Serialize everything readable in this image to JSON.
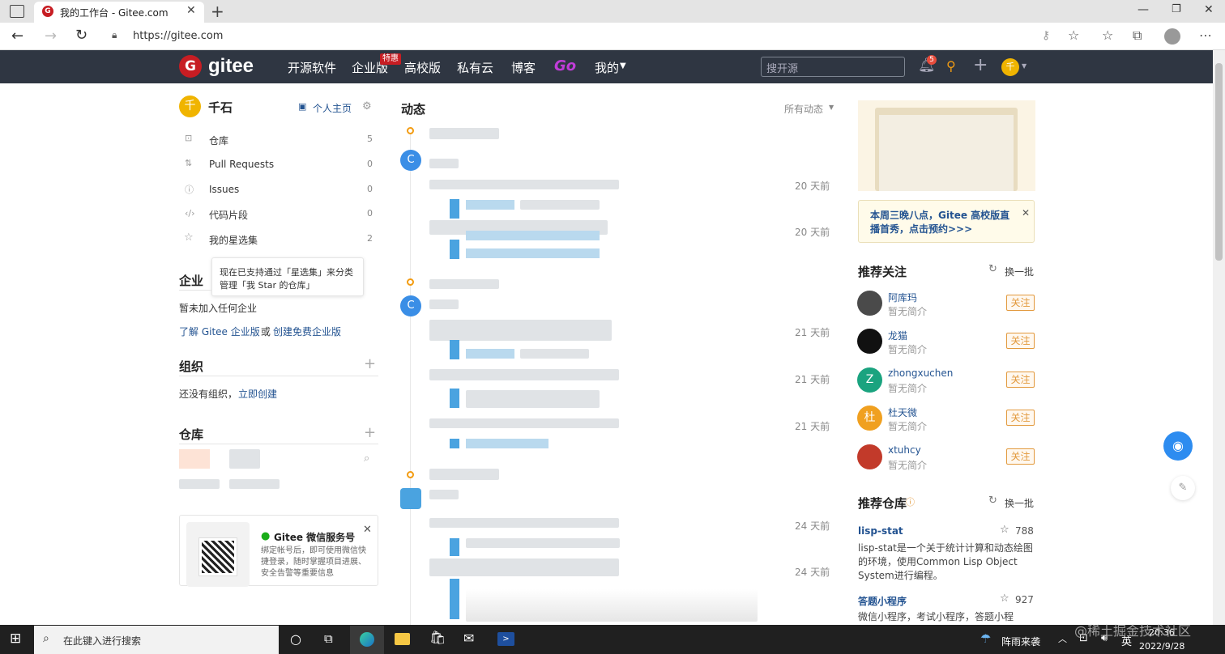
{
  "browser": {
    "tab_title": "我的工作台 - Gitee.com",
    "url": "https://gitee.com"
  },
  "header": {
    "logo": "gitee",
    "nav": [
      "开源软件",
      "企业版",
      "高校版",
      "私有云",
      "博客",
      "Go",
      "我的"
    ],
    "badge_special": "特惠",
    "search_placeholder": "搜开源",
    "notif_count": "5",
    "avatar_char": "千"
  },
  "sidebar": {
    "username": "千石",
    "avatar_char": "千",
    "home_link": "个人主页",
    "items": [
      {
        "label": "仓库",
        "count": "5"
      },
      {
        "label": "Pull Requests",
        "count": "0"
      },
      {
        "label": "Issues",
        "count": "0"
      },
      {
        "label": "代码片段",
        "count": "0"
      },
      {
        "label": "我的星选集",
        "count": "2"
      }
    ],
    "tooltip_line1": "现在已支持通过「星选集」来分类",
    "tooltip_line2": "管理「我 Star 的仓库」",
    "enterprise_title": "企业",
    "enterprise_empty": "暂未加入任何企业",
    "enterprise_link1": "了解 Gitee 企业版",
    "enterprise_or": " 或 ",
    "enterprise_link2": "创建免费企业版",
    "org_title": "组织",
    "org_empty": "还没有组织，",
    "org_create": "立即创建",
    "repo_title": "仓库",
    "wechat_title": "Gitee 微信服务号",
    "wechat_desc": "绑定帐号后，即可使用微信快捷登录，随时掌握项目进展、安全告警等重要信息"
  },
  "feed": {
    "title": "动态",
    "filter": "所有动态",
    "times": [
      "20 天前",
      "20 天前",
      "21 天前",
      "21 天前",
      "21 天前",
      "24 天前",
      "24 天前"
    ]
  },
  "right": {
    "banner_text": "本周三晚八点，Gitee 高校版直播首秀，点击预约>>>",
    "follow_title": "推荐关注",
    "refresh": "换一批",
    "users": [
      {
        "name": "阿库玛",
        "desc": "暂无简介",
        "avatar": "",
        "color": "#4a4a4a"
      },
      {
        "name": "龙猫",
        "desc": "暂无简介",
        "avatar": "",
        "color": "#111111"
      },
      {
        "name": "zhongxuchen",
        "desc": "暂无简介",
        "avatar": "Z",
        "color": "#1aa37f"
      },
      {
        "name": "杜天微",
        "desc": "暂无简介",
        "avatar": "杜",
        "color": "#f0a020"
      },
      {
        "name": "xtuhcy",
        "desc": "暂无简介",
        "avatar": "",
        "color": "#c23a2a"
      }
    ],
    "follow_btn": "关注",
    "repo_title": "推荐仓库",
    "repos": [
      {
        "name": "lisp-stat",
        "stars": "788",
        "desc": "lisp-stat是一个关于统计计算和动态绘图的环境，使用Common Lisp Object System进行编程。"
      },
      {
        "name": "答题小程序",
        "stars": "927",
        "desc": "微信小程序，考试小程序，答题小程"
      }
    ]
  },
  "taskbar": {
    "search": "在此键入进行搜索",
    "weather": "阵雨来袭",
    "ime": "英",
    "time": "20:36",
    "date": "2022/9/28",
    "watermark": "@稀土掘金技术社区"
  }
}
